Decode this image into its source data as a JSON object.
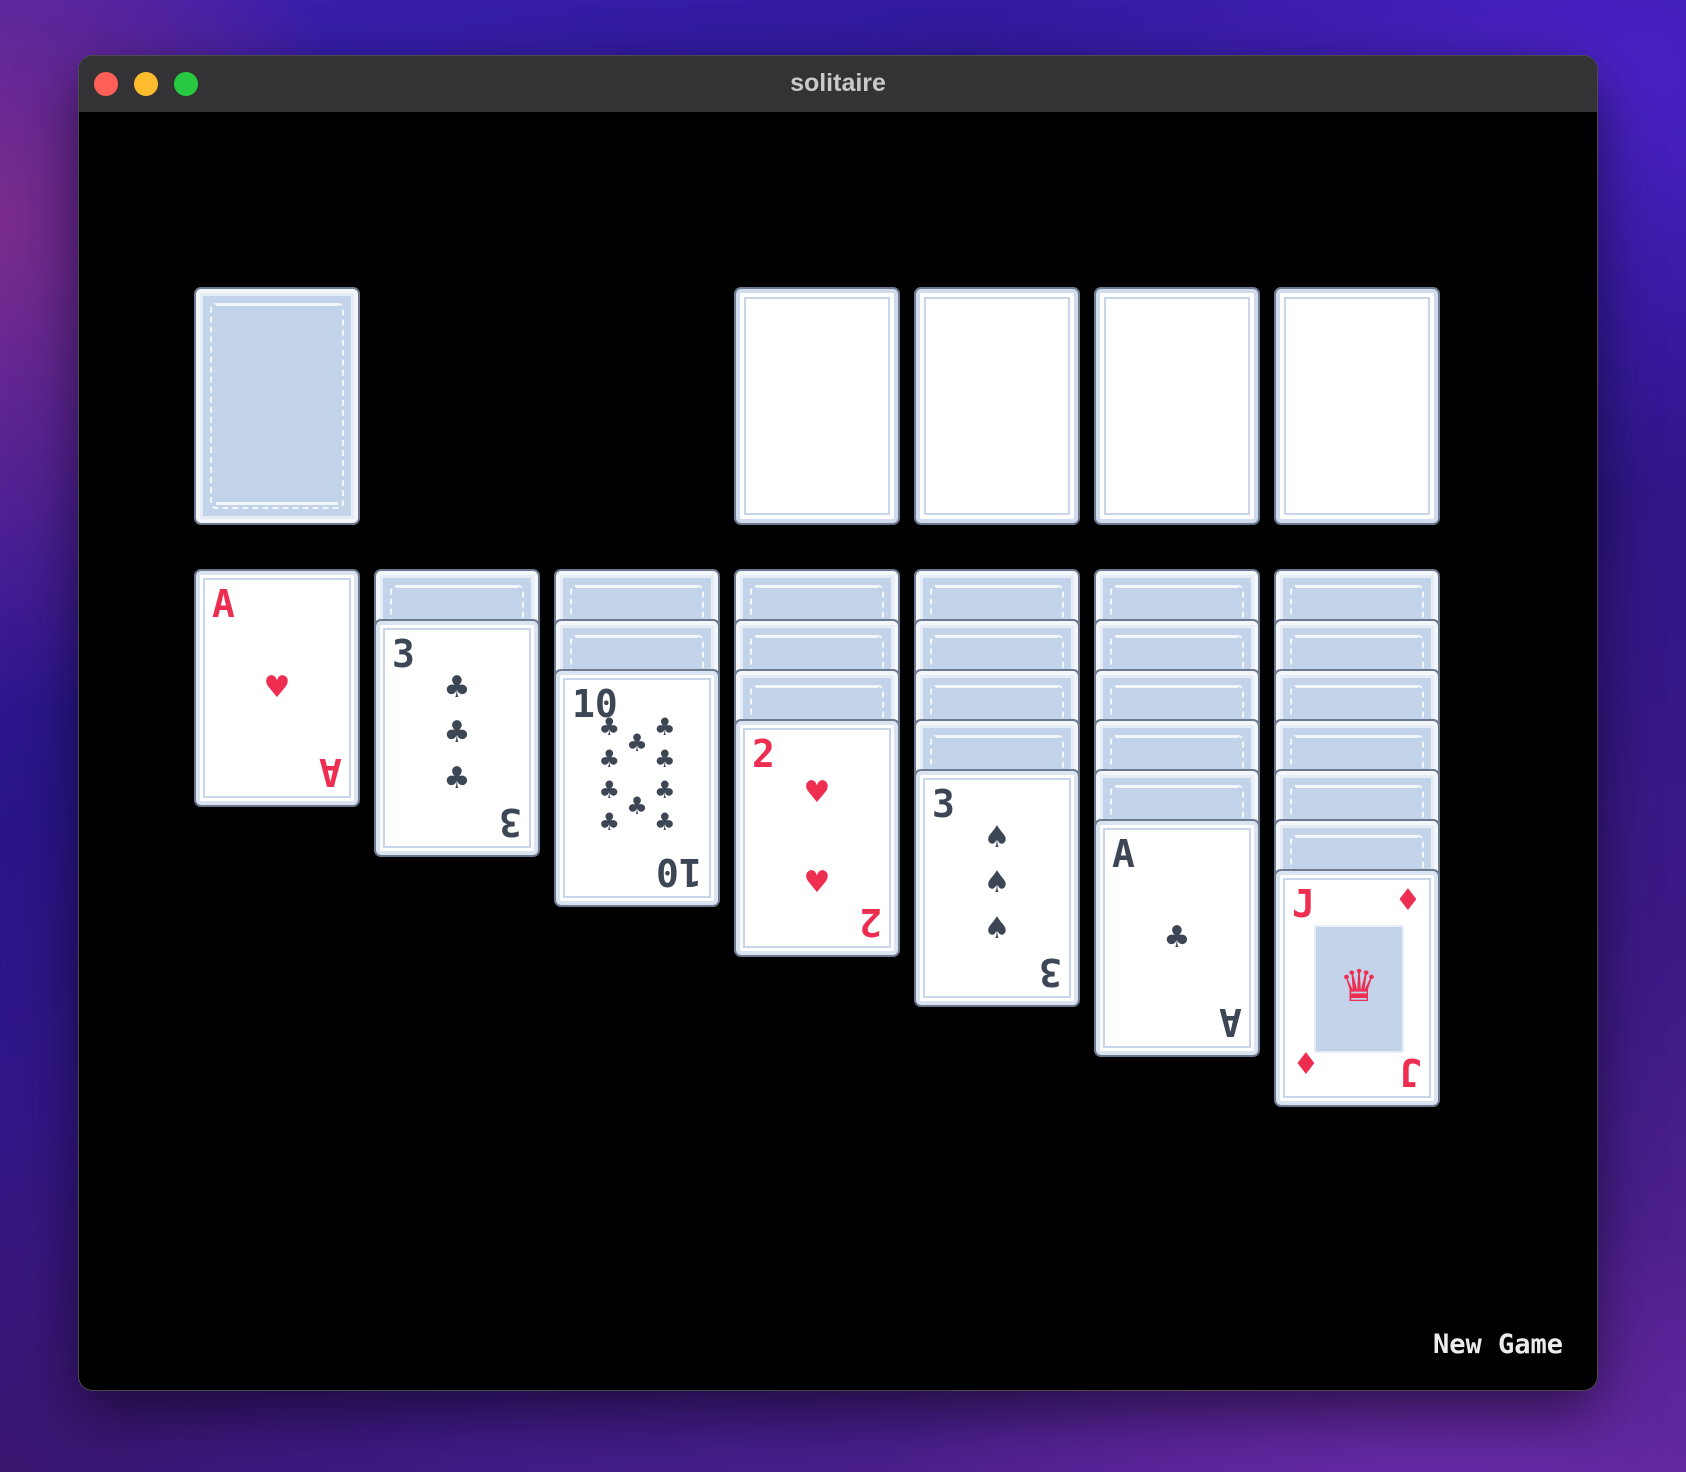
{
  "window": {
    "title": "solitaire"
  },
  "footer": {
    "new_game_label": "New Game"
  },
  "icons": {
    "heart": "♥",
    "club": "♣",
    "spade": "♠",
    "diamond": "♦",
    "crown": "♛"
  },
  "colors": {
    "red_suit": "#ee2e50",
    "dark_suit": "#3d4654",
    "card_back": "#c3d3ea",
    "table": "#000000"
  },
  "stock": {
    "state": "face-down"
  },
  "foundations": [
    {
      "state": "empty"
    },
    {
      "state": "empty"
    },
    {
      "state": "empty"
    },
    {
      "state": "empty"
    }
  ],
  "tableau": [
    {
      "hidden": 0,
      "top": {
        "rank": "A",
        "suit": "heart",
        "color": "red"
      }
    },
    {
      "hidden": 1,
      "top": {
        "rank": "3",
        "suit": "club",
        "color": "dark"
      }
    },
    {
      "hidden": 2,
      "top": {
        "rank": "10",
        "suit": "club",
        "color": "dark"
      }
    },
    {
      "hidden": 3,
      "top": {
        "rank": "2",
        "suit": "heart",
        "color": "red"
      }
    },
    {
      "hidden": 4,
      "top": {
        "rank": "3",
        "suit": "spade",
        "color": "dark"
      }
    },
    {
      "hidden": 5,
      "top": {
        "rank": "A",
        "suit": "club",
        "color": "dark"
      }
    },
    {
      "hidden": 6,
      "top": {
        "rank": "J",
        "suit": "diamond",
        "color": "red"
      }
    }
  ]
}
